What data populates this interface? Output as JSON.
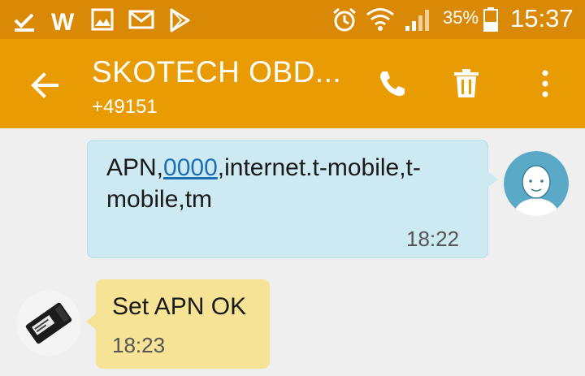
{
  "status_bar": {
    "battery_percent": "35%",
    "time": "15:37",
    "icons": [
      "download-done-icon",
      "word-app-icon",
      "gallery-icon",
      "email-icon",
      "play-store-icon",
      "alarm-icon",
      "wifi-icon",
      "signal-icon",
      "battery-icon"
    ]
  },
  "app_bar": {
    "title": "SKOTECH OBD...",
    "subtitle": "+49151",
    "icons": [
      "back-arrow-icon",
      "phone-icon",
      "trash-icon",
      "overflow-menu-icon"
    ]
  },
  "messages": [
    {
      "direction": "outgoing",
      "text_before": "APN,",
      "link": "0000",
      "text_after": ",internet.t-mobile,t-mobile,tm",
      "time": "18:22",
      "avatar": "default-contact-avatar"
    },
    {
      "direction": "incoming",
      "text": "Set APN OK",
      "time": "18:23",
      "avatar": "obd-device-avatar"
    }
  ],
  "colors": {
    "status_bar": "#d98906",
    "app_bar": "#e99b04",
    "outgoing_bubble": "#cde9f1",
    "incoming_bubble": "#f6e395",
    "background": "#efefef"
  }
}
